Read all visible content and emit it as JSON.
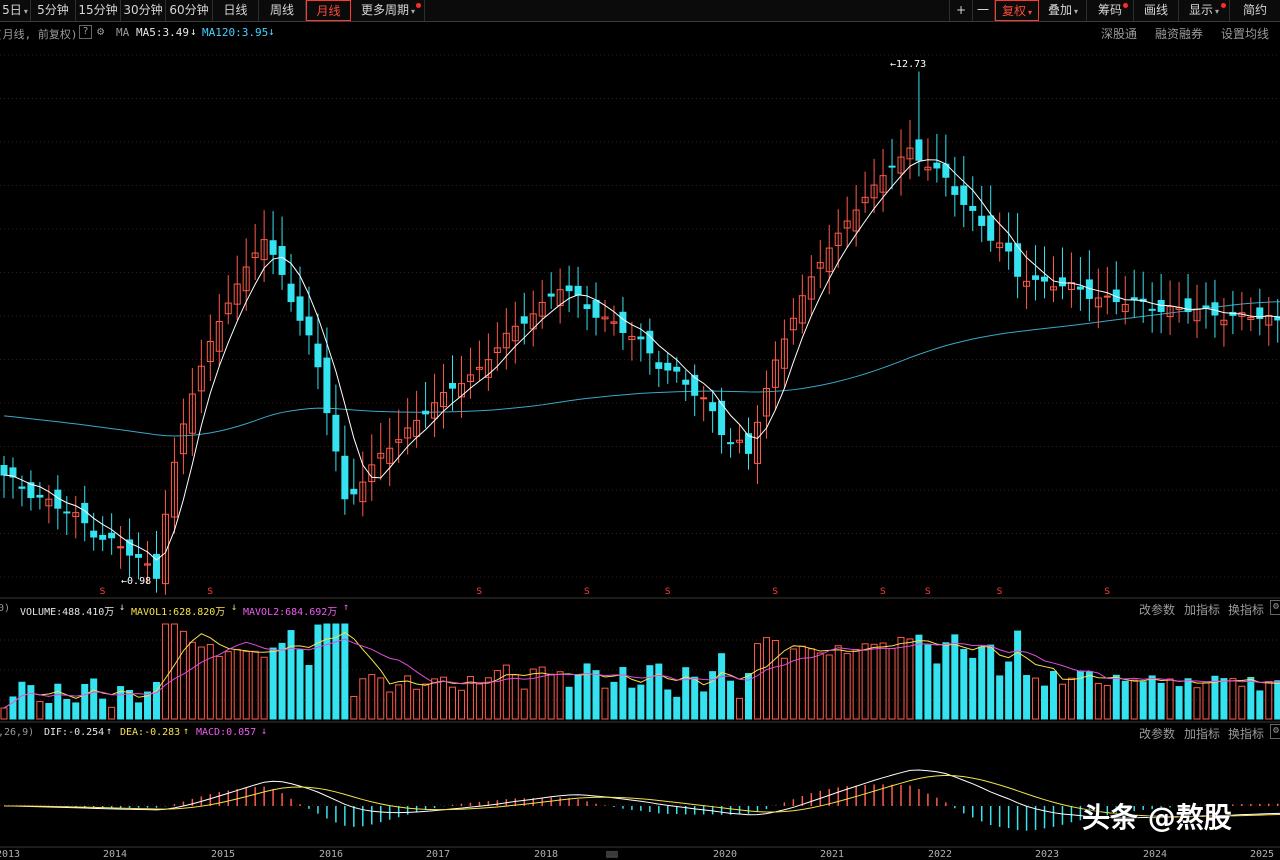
{
  "toolbar": {
    "period_cut": "5日",
    "periods": [
      "5分钟",
      "15分钟",
      "30分钟",
      "60分钟",
      "日线",
      "周线",
      "月线"
    ],
    "more_periods": "更多周期",
    "plus": "+",
    "minus": "一",
    "fuquan": "复权",
    "overlay": "叠加",
    "chips": "筹码",
    "draw": "画线",
    "display": "显示",
    "simple": "简约"
  },
  "main_panel": {
    "label": "(月线, 前复权)",
    "help": "?",
    "ma_label": "MA",
    "ma5": "MA5:3.49",
    "ma120": "MA120:3.95",
    "links": [
      "深股通",
      "融资融券",
      "设置均线"
    ],
    "high_label": "12.73",
    "low_label": "0.98",
    "dividend_marker": "S"
  },
  "volume_panel": {
    "paren": "0)",
    "volume": "VOLUME:488.410万",
    "mavol1": "MAVOL1:628.820万",
    "mavol2": "MAVOL2:684.692万",
    "buttons": [
      "改参数",
      "加指标",
      "换指标"
    ]
  },
  "macd_panel": {
    "params": ",26,9)",
    "dif": "DIF:-0.254",
    "dea": "DEA:-0.283",
    "macd": "MACD:0.057",
    "buttons": [
      "改参数",
      "加指标",
      "换指标"
    ]
  },
  "years": [
    "2013",
    "2014",
    "2015",
    "2016",
    "2017",
    "2018",
    "2019",
    "2020",
    "2021",
    "2022",
    "2023",
    "2024",
    "2025"
  ],
  "watermark": "头条 @熬股",
  "colors": {
    "up": "#ff5a4a",
    "down": "#35e3f0",
    "ma5": "#ffffff",
    "ma120": "#3aa7c8",
    "mavol1": "#f5e24a",
    "mavol2": "#e04ce0",
    "dif": "#ffffff",
    "dea": "#f5e24a"
  },
  "chart_data": {
    "type": "candlestick",
    "period": "monthly",
    "price_anchors": [
      {
        "x": "2013-01",
        "close": 1.6
      },
      {
        "x": "2014-01",
        "close": 1.15
      },
      {
        "x": "2014-06",
        "close": 0.98
      },
      {
        "x": "2015-06",
        "close": 5.4
      },
      {
        "x": "2016-03",
        "close": 1.4
      },
      {
        "x": "2017-06",
        "close": 2.8
      },
      {
        "x": "2018-03",
        "close": 4.2
      },
      {
        "x": "2019-12",
        "close": 1.75
      },
      {
        "x": "2021-06",
        "close": 8.6
      },
      {
        "x": "2021-07",
        "high": 12.73
      },
      {
        "x": "2022-06",
        "close": 4.5
      },
      {
        "x": "2023-06",
        "close": 3.9
      },
      {
        "x": "2025-03",
        "close": 3.49
      }
    ],
    "ma5_last": 3.49,
    "ma120_last": 3.95,
    "volume_last": "488.410万",
    "mavol1_last": "628.820万",
    "mavol2_last": "684.692万",
    "dif_last": -0.254,
    "dea_last": -0.283,
    "macd_last": 0.057
  }
}
